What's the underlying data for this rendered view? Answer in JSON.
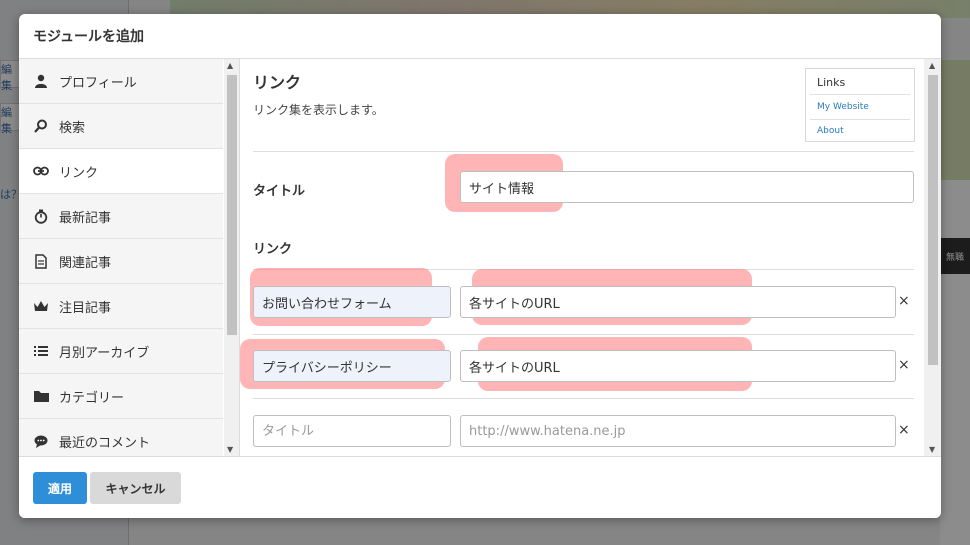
{
  "modal": {
    "title": "モジュールを追加",
    "apply_label": "適用",
    "cancel_label": "キャンセル"
  },
  "sidebar": {
    "items": [
      {
        "label": "プロフィール",
        "icon": "person-icon"
      },
      {
        "label": "検索",
        "icon": "search-icon"
      },
      {
        "label": "リンク",
        "icon": "link-icon"
      },
      {
        "label": "最新記事",
        "icon": "stopwatch-icon"
      },
      {
        "label": "関連記事",
        "icon": "document-icon"
      },
      {
        "label": "注目記事",
        "icon": "crown-icon"
      },
      {
        "label": "月別アーカイブ",
        "icon": "list-icon"
      },
      {
        "label": "カテゴリー",
        "icon": "folder-icon"
      },
      {
        "label": "最近のコメント",
        "icon": "comment-icon"
      }
    ],
    "active": "リンク"
  },
  "module": {
    "title": "リンク",
    "description": "リンク集を表示します。",
    "preview": {
      "title": "Links",
      "links": [
        "My Website",
        "About"
      ]
    }
  },
  "form": {
    "title_label": "タイトル",
    "title_value": "サイト情報",
    "links_label": "リンク",
    "rows": [
      {
        "title": "お問い合わせフォーム",
        "url": "各サイトのURL"
      },
      {
        "title": "プライバシーポリシー",
        "url": "各サイトのURL"
      }
    ],
    "new_row": {
      "title_placeholder": "タイトル",
      "url_placeholder": "http://www.hatena.ne.jp"
    },
    "remove_symbol": "×"
  },
  "background": {
    "edit_label": "編集",
    "dark_bar_text": "無職",
    "question_fragment": "は？"
  },
  "colors": {
    "accent": "#2f8ed8",
    "highlight": "#ff7878"
  }
}
